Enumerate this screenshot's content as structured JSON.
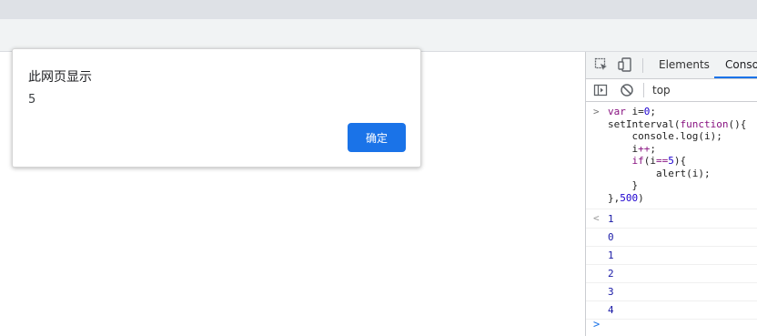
{
  "dialog": {
    "title": "此网页显示",
    "message": "5",
    "ok_label": "确定"
  },
  "devtools": {
    "tabs": [
      "Elements",
      "Console"
    ],
    "active_tab": "Console",
    "context": "top",
    "input_prompt": ">",
    "result_glyph": "<",
    "code_lines": [
      "var i=0;",
      "setInterval(function(){",
      "    console.log(i);",
      "    i++;",
      "    if(i==5){",
      "        alert(i);",
      "    }",
      "},500)"
    ],
    "return_value": "1",
    "log_values": [
      "0",
      "1",
      "2",
      "3",
      "4"
    ],
    "caret": ">"
  },
  "colors": {
    "accent": "#1a73e8",
    "log_number": "#1a1aa6",
    "keyword": "#881280",
    "number_literal": "#1c00cf"
  }
}
